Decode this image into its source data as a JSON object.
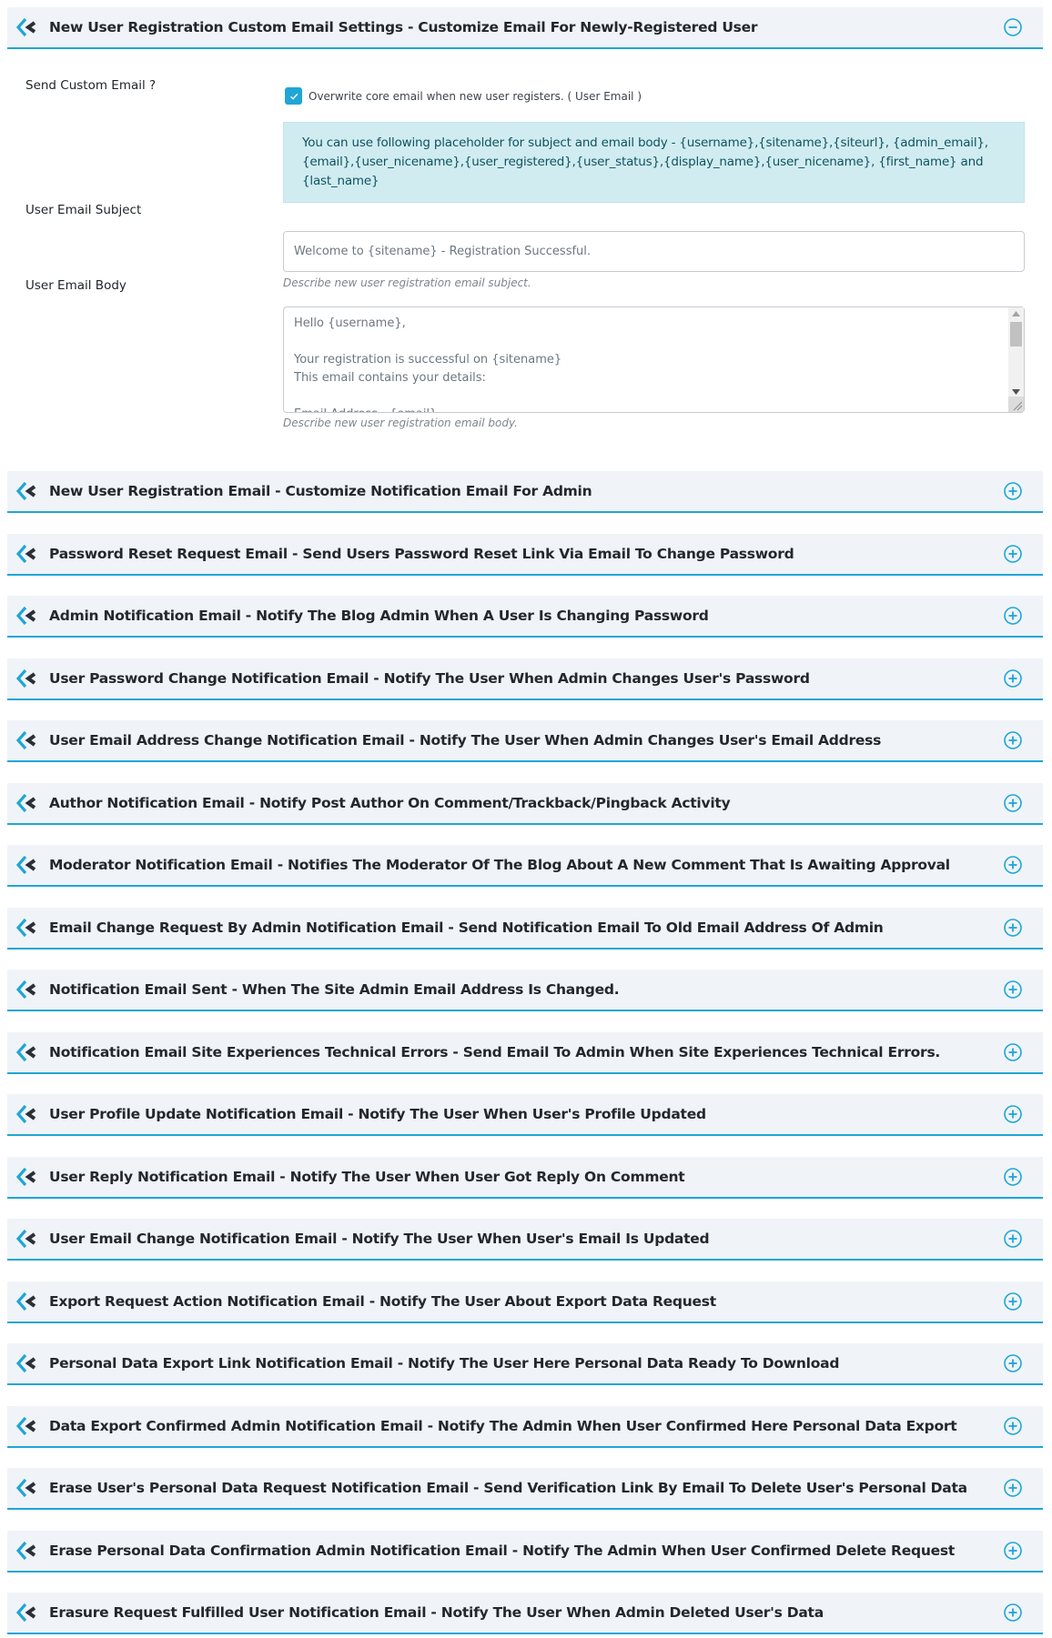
{
  "colors": {
    "accent": "#1fa6d6",
    "header_bg": "#f0f4f8",
    "info_bg": "#d1ecf1",
    "logo_dark": "#2b2f38"
  },
  "expanded_section": {
    "title": "New User Registration Custom Email Settings - Customize Email For Newly-Registered User",
    "toggle_icon": "minus-circle-icon",
    "send_custom_email": {
      "label": "Send Custom Email ?",
      "checkbox_label": "Overwrite core email when new user registers. ( User Email )",
      "checked": true
    },
    "placeholder_info": "You can use following placeholder for subject and email body - {username},{sitename},{siteurl}, {admin_email},{email},{user_nicename},{user_registered},{user_status},{display_name},{user_nicename}, {first_name} and {last_name}",
    "subject": {
      "label": "User Email Subject",
      "value": "Welcome to {sitename} - Registration Successful.",
      "help": "Describe new user registration email subject."
    },
    "body": {
      "label": "User Email Body",
      "value": "Hello {username},\n\nYour registration is successful on {sitename}\nThis email contains your details:\n\nEmail Address - {email}",
      "help": "Describe new user registration email body."
    }
  },
  "collapsed_sections": [
    {
      "title": "New User Registration Email - Customize Notification Email For Admin"
    },
    {
      "title": "Password Reset Request Email - Send Users Password Reset Link Via Email To Change Password"
    },
    {
      "title": "Admin Notification Email - Notify The Blog Admin When A User Is Changing Password"
    },
    {
      "title": "User Password Change Notification Email - Notify The User When Admin Changes User's Password"
    },
    {
      "title": "User Email Address Change Notification Email - Notify The User When Admin Changes User's Email Address"
    },
    {
      "title": "Author Notification Email - Notify Post Author On Comment/Trackback/Pingback Activity"
    },
    {
      "title": "Moderator Notification Email - Notifies The Moderator Of The Blog About A New Comment That Is Awaiting Approval"
    },
    {
      "title": "Email Change Request By Admin Notification Email - Send Notification Email To Old Email Address Of Admin"
    },
    {
      "title": "Notification Email Sent - When The Site Admin Email Address Is Changed."
    },
    {
      "title": "Notification Email Site Experiences Technical Errors - Send Email To Admin When Site Experiences Technical Errors."
    },
    {
      "title": "User Profile Update Notification Email - Notify The User When User's Profile Updated"
    },
    {
      "title": "User Reply Notification Email - Notify The User When User Got Reply On Comment"
    },
    {
      "title": "User Email Change Notification Email - Notify The User When User's Email Is Updated"
    },
    {
      "title": "Export Request Action Notification Email - Notify The User About Export Data Request"
    },
    {
      "title": "Personal Data Export Link Notification Email - Notify The User Here Personal Data Ready To Download"
    },
    {
      "title": "Data Export Confirmed Admin Notification Email - Notify The Admin When User Confirmed Here Personal Data Export"
    },
    {
      "title": "Erase User's Personal Data Request Notification Email - Send Verification Link By Email To Delete User's Personal Data"
    },
    {
      "title": "Erase Personal Data Confirmation Admin Notification Email - Notify The Admin When User Confirmed Delete Request"
    },
    {
      "title": "Erasure Request Fulfilled User Notification Email - Notify The User When Admin Deleted User's Data"
    }
  ]
}
